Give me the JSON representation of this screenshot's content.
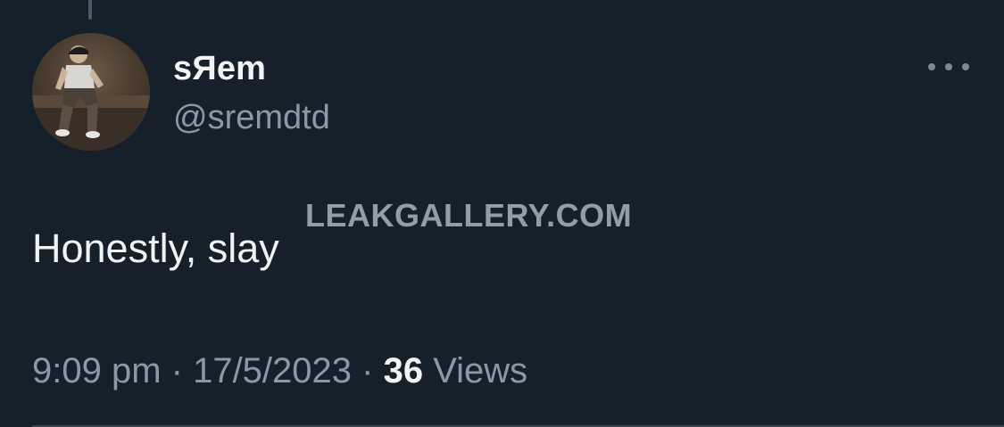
{
  "tweet": {
    "author": {
      "display_name": "sЯem",
      "handle": "@sremdtd",
      "avatar_icon": "profile-photo"
    },
    "text": "Honestly, slay",
    "time": "9:09 pm",
    "separator": " · ",
    "date": "17/5/2023",
    "views_count": "36",
    "views_label": " Views",
    "more_icon": "more-horizontal-icon"
  },
  "watermark": "LEAKGALLERY.COM",
  "colors": {
    "background": "#15202b",
    "primary_text": "#e7e9ea",
    "secondary_text": "#8b98a5"
  }
}
